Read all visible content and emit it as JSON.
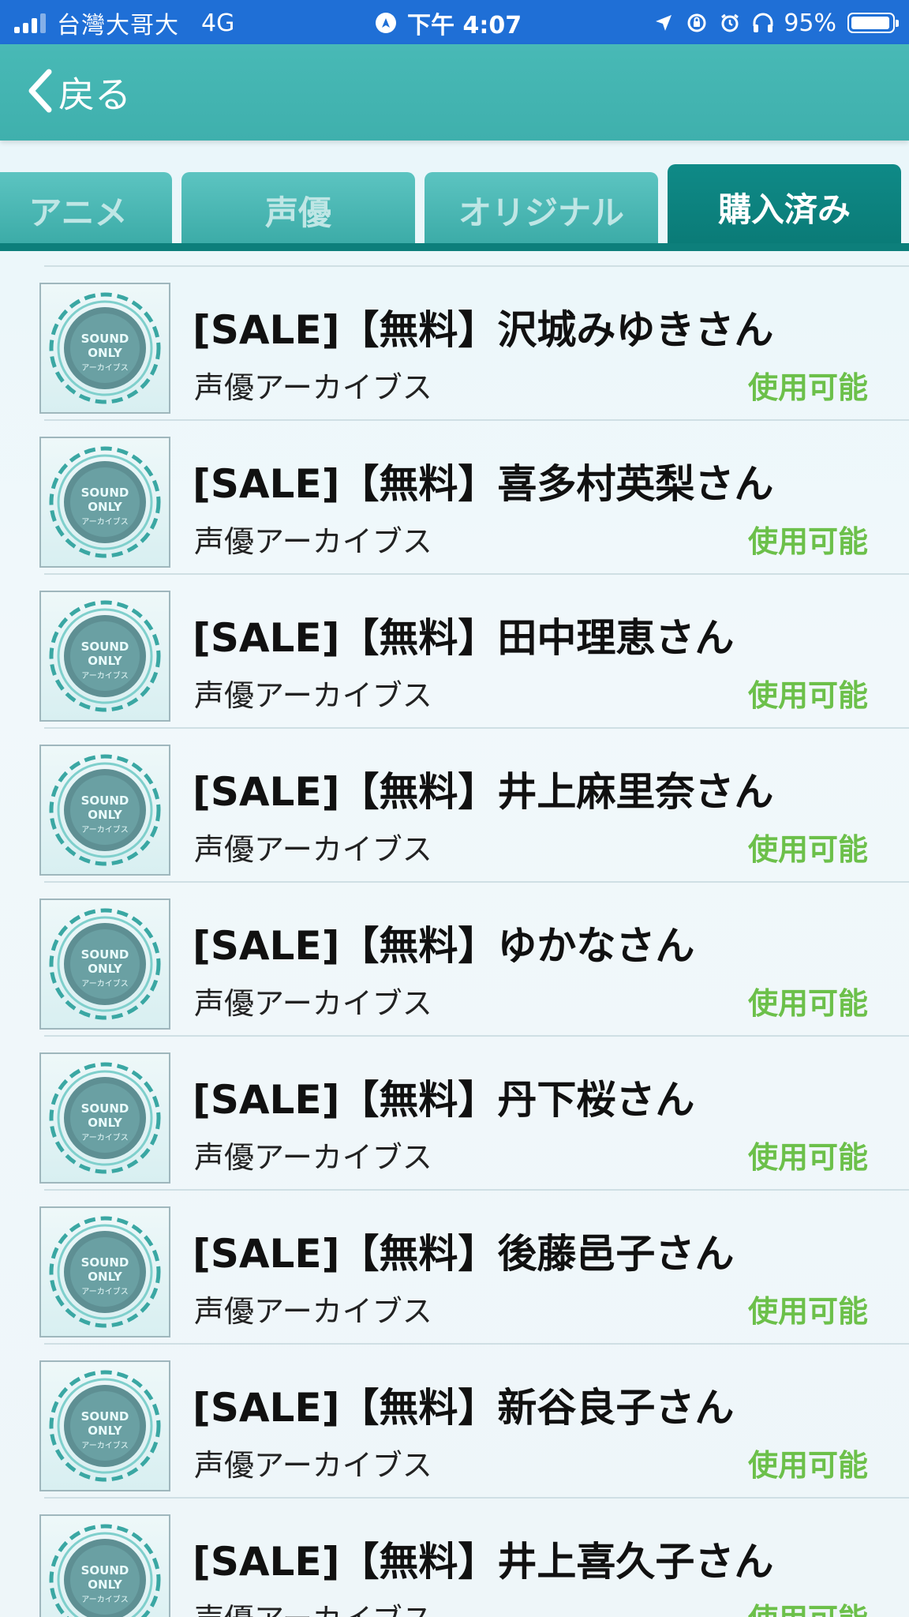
{
  "status_bar": {
    "carrier": "台灣大哥大",
    "network": "4G",
    "time": "下午 4:07",
    "battery": "95%"
  },
  "nav": {
    "back_label": "戻る"
  },
  "tabs": [
    {
      "label": "アニメ",
      "active": false
    },
    {
      "label": "声優",
      "active": false
    },
    {
      "label": "オリジナル",
      "active": false
    },
    {
      "label": "購入済み",
      "active": true
    }
  ],
  "items": [
    {
      "title": "[SALE]【無料】沢城みゆきさん",
      "subtitle": "声優アーカイブス",
      "status": "使用可能"
    },
    {
      "title": "[SALE]【無料】喜多村英梨さん",
      "subtitle": "声優アーカイブス",
      "status": "使用可能"
    },
    {
      "title": "[SALE]【無料】田中理恵さん",
      "subtitle": "声優アーカイブス",
      "status": "使用可能"
    },
    {
      "title": "[SALE]【無料】井上麻里奈さん",
      "subtitle": "声優アーカイブス",
      "status": "使用可能"
    },
    {
      "title": "[SALE]【無料】ゆかなさん",
      "subtitle": "声優アーカイブス",
      "status": "使用可能"
    },
    {
      "title": "[SALE]【無料】丹下桜さん",
      "subtitle": "声優アーカイブス",
      "status": "使用可能"
    },
    {
      "title": "[SALE]【無料】後藤邑子さん",
      "subtitle": "声優アーカイブス",
      "status": "使用可能"
    },
    {
      "title": "[SALE]【無料】新谷良子さん",
      "subtitle": "声優アーカイブス",
      "status": "使用可能"
    },
    {
      "title": "[SALE]【無料】井上喜久子さん",
      "subtitle": "声優アーカイブス",
      "status": "使用可能"
    }
  ],
  "thumbnail": {
    "line1": "SOUND",
    "line2": "ONLY",
    "line3": "アーカイブス"
  },
  "colors": {
    "status_bar": "#1f6fd6",
    "nav_bar": "#45b6b3",
    "tab_active": "#0d7f7b",
    "status_text": "#6cc04a"
  }
}
